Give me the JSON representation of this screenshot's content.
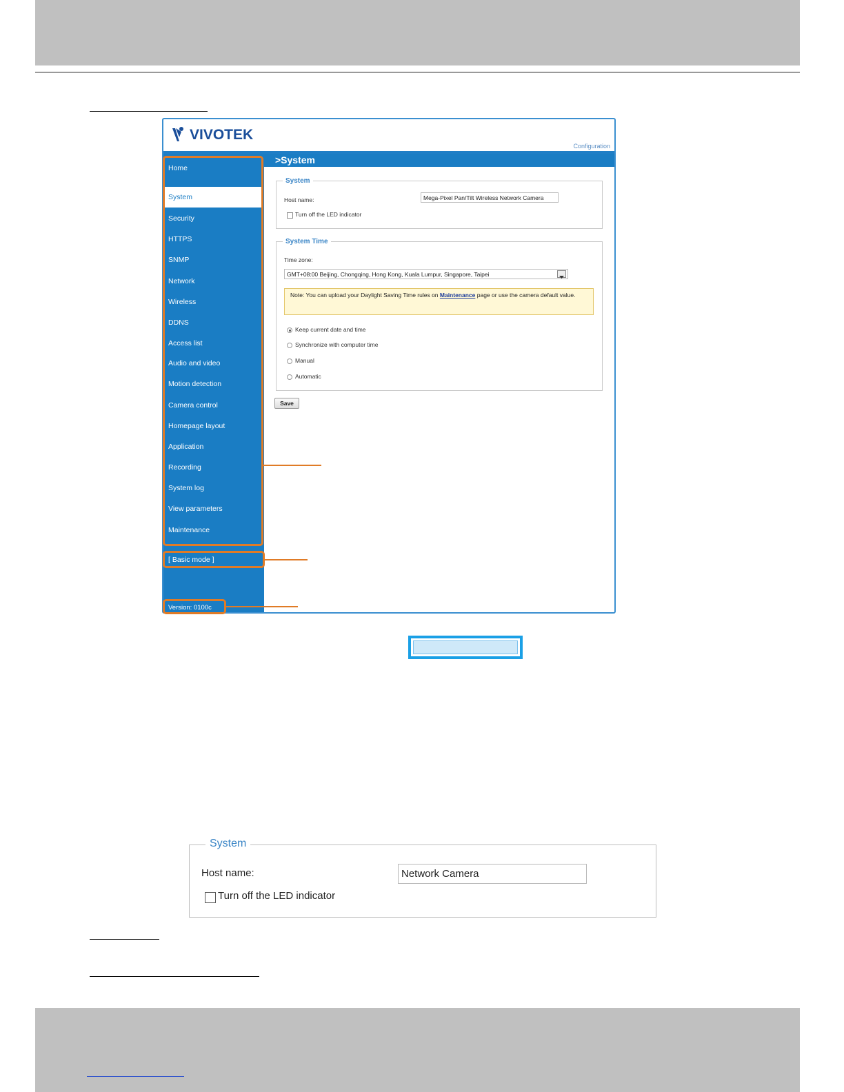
{
  "screenshot": {
    "logo_text": "VIVOTEK",
    "config_link": "Configuration",
    "title": ">System",
    "nav_items": [
      "Home",
      "System",
      "Security",
      "HTTPS",
      "SNMP",
      "Network",
      "Wireless",
      "DDNS",
      "Access list",
      "Audio and video",
      "Motion detection",
      "Camera control",
      "Homepage layout",
      "Application",
      "Recording",
      "System log",
      "View parameters",
      "Maintenance"
    ],
    "active_nav": "System",
    "basic_mode": "[ Basic mode ]",
    "version": "Version: 0100c",
    "system_section": {
      "legend": "System",
      "host_label": "Host name:",
      "host_value": "Mega-Pixel Pan/Tilt Wireless Network Camera",
      "led_label": "Turn off the LED indicator"
    },
    "time_section": {
      "legend": "System Time",
      "timezone_label": "Time zone:",
      "timezone_value": "GMT+08:00 Beijing, Chongqing, Hong Kong, Kuala Lumpur, Singapore, Taipei",
      "note_prefix": "Note: You can upload your Daylight Saving Time rules on ",
      "note_link": "Maintenance",
      "note_suffix": " page or use the camera default value.",
      "options": [
        "Keep current date and time",
        "Synchronize with computer time",
        "Manual",
        "Automatic"
      ],
      "selected_option": "Keep current date and time"
    },
    "save_label": "Save"
  },
  "detail_panel": {
    "legend": "System",
    "host_label": "Host name:",
    "host_value": "Network Camera",
    "led_label": "Turn off the LED indicator"
  },
  "colors": {
    "sidebar_blue": "#1a7dc4",
    "callout_orange": "#e07b26",
    "band_gray": "#c0c0c0",
    "highlight_blue": "#1aa0e6"
  }
}
